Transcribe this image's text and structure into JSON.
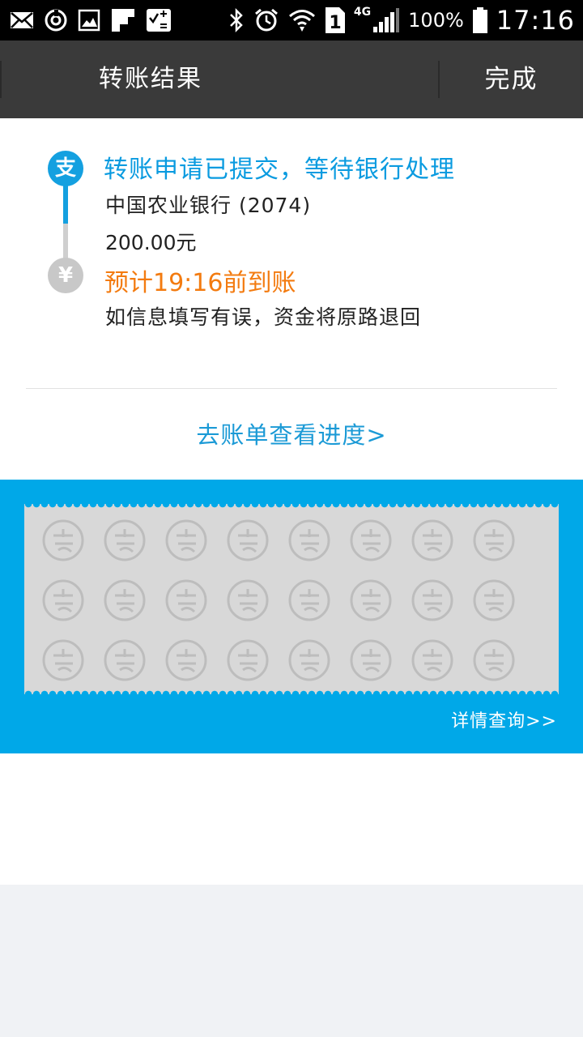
{
  "status_bar": {
    "battery": "100%",
    "time": "17:16",
    "network": "4G"
  },
  "header": {
    "title": "转账结果",
    "done_label": "完成"
  },
  "timeline": {
    "top_icon": "支",
    "bottom_icon": "¥",
    "status": "转账申请已提交，等待银行处理",
    "bank": "中国农业银行  (2074)",
    "amount": "200.00元",
    "eta": "预计19:16前到账",
    "note": "如信息填写有误，资金将原路退回"
  },
  "progress_link": "去账单查看进度>",
  "banner": {
    "detail_link": "详情查询>>"
  },
  "colors": {
    "accent_blue": "#14a0e0",
    "orange": "#f37b10",
    "banner_blue": "#00a8e8",
    "titlebar": "#3a3a3a"
  }
}
